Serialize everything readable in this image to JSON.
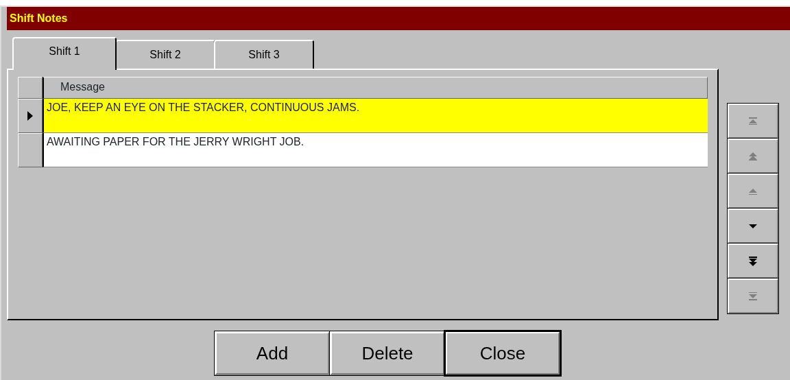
{
  "window": {
    "title": "Shift Notes"
  },
  "tabs": [
    {
      "label": "Shift 1",
      "selected": true
    },
    {
      "label": "Shift 2",
      "selected": false
    },
    {
      "label": "Shift 3",
      "selected": false
    }
  ],
  "grid": {
    "columns": [
      "Message"
    ],
    "rows": [
      {
        "message": "JOE, KEEP AN EYE ON THE STACKER, CONTINUOUS JAMS.",
        "selected": true
      },
      {
        "message": "AWAITING PAPER FOR THE JERRY WRIGHT JOB.",
        "selected": false
      }
    ]
  },
  "navigator": [
    {
      "kind": "first",
      "disabled": true
    },
    {
      "kind": "page-up",
      "disabled": true
    },
    {
      "kind": "up",
      "disabled": true
    },
    {
      "kind": "down",
      "disabled": false
    },
    {
      "kind": "page-down",
      "disabled": false
    },
    {
      "kind": "last",
      "disabled": true
    }
  ],
  "buttons": [
    {
      "label": "Add",
      "default": false
    },
    {
      "label": "Delete",
      "default": false
    },
    {
      "label": "Close",
      "default": true
    }
  ]
}
